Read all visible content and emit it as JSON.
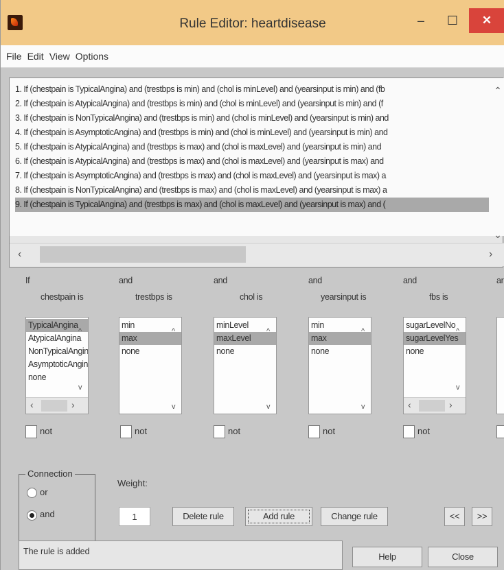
{
  "window": {
    "title": "Rule Editor: heartdisease",
    "minimize": "–",
    "maximize": "☐",
    "close": "✕",
    "icon": "matlab-icon"
  },
  "menu": [
    "File",
    "Edit",
    "View",
    "Options"
  ],
  "rules": [
    "1. If (chestpain is TypicalAngina) and (trestbps is min) and (chol is minLevel) and (yearsinput is min) and (fb",
    "2. If (chestpain is AtypicalAngina) and (trestbps is min) and (chol is minLevel) and (yearsinput is min) and (f",
    "3. If (chestpain is NonTypicalAngina) and (trestbps is min) and (chol is minLevel) and (yearsinput is min) and",
    "4. If (chestpain is AsymptoticAngina) and (trestbps is min) and (chol is minLevel) and (yearsinput is min) and",
    "5. If (chestpain is AtypicalAngina) and (trestbps is max) and (chol is maxLevel) and (yearsinput is min) and",
    "6. If (chestpain is AtypicalAngina) and (trestbps is max) and (chol is maxLevel) and (yearsinput is max) and",
    "7. If (chestpain is AsymptoticAngina) and (trestbps is max) and (chol is maxLevel) and (yearsinput is max) a",
    "8. If (chestpain is NonTypicalAngina) and (trestbps is max) and (chol is maxLevel) and (yearsinput is max) a",
    "9. If (chestpain is TypicalAngina) and (trestbps is max) and (chol is maxLevel) and (yearsinput is max) and ("
  ],
  "selected_rule": 8,
  "columns": [
    {
      "connector": "If",
      "label": "chestpain is",
      "items": [
        "TypicalAngina",
        "AtypicalAngina",
        "NonTypicalAngina",
        "AsymptoticAngina",
        "none"
      ],
      "selected": 0,
      "not_label": "not"
    },
    {
      "connector": "and",
      "label": "trestbps is",
      "items": [
        "min",
        "max",
        "none"
      ],
      "selected": 1,
      "not_label": "not"
    },
    {
      "connector": "and",
      "label": "chol is",
      "items": [
        "minLevel",
        "maxLevel",
        "none"
      ],
      "selected": 1,
      "not_label": "not"
    },
    {
      "connector": "and",
      "label": "yearsinput is",
      "items": [
        "min",
        "max",
        "none"
      ],
      "selected": 1,
      "not_label": "not"
    },
    {
      "connector": "and",
      "label": "fbs is",
      "items": [
        "sugarLevelNo",
        "sugarLevelYes",
        "none"
      ],
      "selected": 1,
      "not_label": "not"
    }
  ],
  "partial_column": {
    "connector": "ar"
  },
  "connection": {
    "title": "Connection",
    "or_label": "or",
    "and_label": "and",
    "selected": "and"
  },
  "weight": {
    "label": "Weight:",
    "value": "1"
  },
  "buttons": {
    "delete": "Delete rule",
    "add": "Add rule",
    "change": "Change rule",
    "prev": "<<",
    "next": ">>",
    "help": "Help",
    "close": "Close"
  },
  "status": "The rule is added"
}
